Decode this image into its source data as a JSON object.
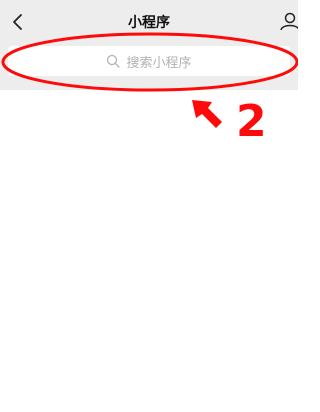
{
  "header": {
    "title": "小程序"
  },
  "search": {
    "placeholder": "搜索小程序"
  },
  "annotation": {
    "step_number": "2",
    "color": "#ff0a0a"
  },
  "icons": {
    "back": "chevron-left-icon",
    "profile": "person-icon",
    "search": "search-icon",
    "pointer": "arrow-icon"
  }
}
